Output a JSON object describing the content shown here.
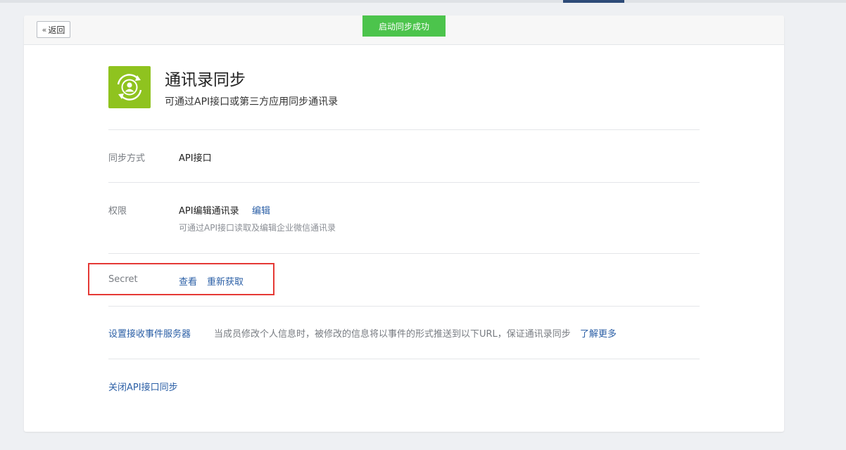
{
  "header": {
    "back_label": "返回",
    "toast": "启动同步成功"
  },
  "app": {
    "title": "通讯录同步",
    "description": "可通过API接口或第三方应用同步通讯录",
    "icon_color": "#8fc31f"
  },
  "sync_method": {
    "label": "同步方式",
    "value": "API接口"
  },
  "permission": {
    "label": "权限",
    "value": "API编辑通讯录",
    "edit_link": "编辑",
    "hint": "可通过API接口读取及编辑企业微信通讯录"
  },
  "secret": {
    "label": "Secret",
    "view_link": "查看",
    "refresh_link": "重新获取"
  },
  "event_server": {
    "link": "设置接收事件服务器",
    "description": "当成员修改个人信息时，被修改的信息将以事件的形式推送到以下URL，保证通讯录同步",
    "learn_more": "了解更多"
  },
  "close_sync": {
    "link": "关闭API接口同步"
  },
  "colors": {
    "link": "#2b5fa6",
    "toast": "#4cc44c",
    "highlight": "#e53935"
  }
}
